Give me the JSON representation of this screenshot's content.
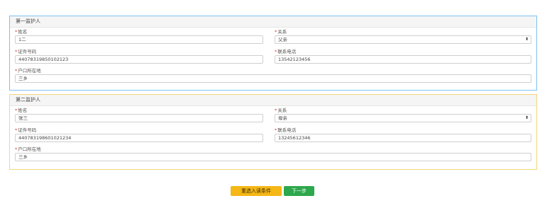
{
  "guardian_1": {
    "header": "第一监护人",
    "name_label": "*姓名",
    "name_value": "1二",
    "relation_label": "*关系",
    "relation_value": "父亲",
    "id_label": "*证件号码",
    "id_value": "44078319850102123",
    "phone_label": "*联系电话",
    "phone_value": "13542123456",
    "household_label": "*户口所在地",
    "household_value": "三乡"
  },
  "guardian_2": {
    "header": "第二监护人",
    "name_label": "*姓名",
    "name_value": "张三",
    "relation_label": "*关系",
    "relation_value": "母亲",
    "id_label": "*证件号码",
    "id_value": "440783198601021234",
    "phone_label": "*联系电话",
    "phone_value": "13245612346",
    "household_label": "*户口所在地",
    "household_value": "三乡"
  },
  "actions": {
    "reselect_label": "重选入读条件",
    "next_label": "下一步"
  },
  "colors": {
    "panel1_border": "#7cc2ef",
    "panel2_border": "#f3d97a",
    "reselect_button": "#f5b716",
    "next_button": "#2da84d",
    "required_marker": "#e53935"
  }
}
